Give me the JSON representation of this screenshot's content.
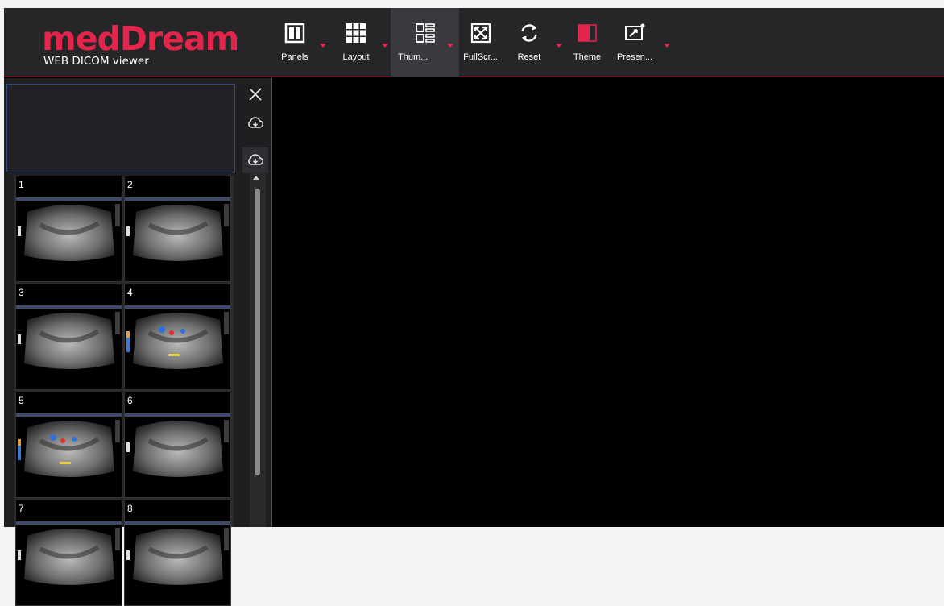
{
  "brand": {
    "name": "medDream",
    "subtitle": "WEB DICOM viewer"
  },
  "toolbar": [
    {
      "id": "panels",
      "label": "Panels",
      "icon": "panels-icon",
      "caret": true,
      "active": false
    },
    {
      "id": "layout",
      "label": "Layout",
      "icon": "layout-grid-icon",
      "caret": true,
      "active": false
    },
    {
      "id": "thumbnails",
      "label": "Thum...",
      "icon": "thumbnails-icon",
      "caret": true,
      "active": true
    },
    {
      "id": "fullscreen",
      "label": "FullScr...",
      "icon": "fullscreen-icon",
      "caret": false,
      "active": false
    },
    {
      "id": "reset",
      "label": "Reset",
      "icon": "reset-icon",
      "caret": true,
      "active": false
    },
    {
      "id": "theme",
      "label": "Theme",
      "icon": "theme-icon",
      "caret": false,
      "active": false
    },
    {
      "id": "presentation",
      "label": "Presen...",
      "icon": "presentation-icon",
      "caret": true,
      "active": false
    }
  ],
  "thumbnails": [
    {
      "number": "1",
      "doppler": false
    },
    {
      "number": "2",
      "doppler": false
    },
    {
      "number": "3",
      "doppler": false
    },
    {
      "number": "4",
      "doppler": true
    },
    {
      "number": "5",
      "doppler": true
    },
    {
      "number": "6",
      "doppler": false
    },
    {
      "number": "7",
      "doppler": false
    },
    {
      "number": "8",
      "doppler": false
    }
  ],
  "colors": {
    "accent": "#e5244b",
    "selection_border": "#2d4e80",
    "toolbar_bg": "#262629",
    "sidebar_bg": "#1f1f22"
  }
}
